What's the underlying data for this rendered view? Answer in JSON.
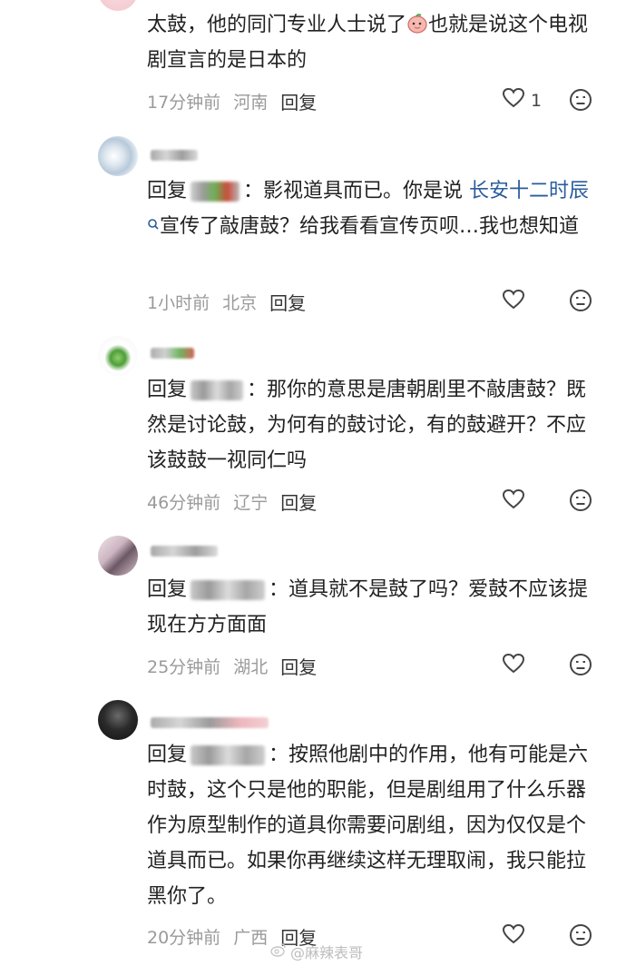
{
  "comments": [
    {
      "text_a": "太鼓，他的同门专业人士说了",
      "text_b": "也就是说这个电视剧宣言的是日本的",
      "time": "17分钟前",
      "location": "河南",
      "reply_label": "回复",
      "likes": "1"
    },
    {
      "reply_word": "回复",
      "text_a": "：影视道具而已。你是说 ",
      "link": "长安十二时辰",
      "text_b": "宣传了敲唐鼓？给我看看宣传页呗…我也想知道",
      "time": "1小时前",
      "location": "北京",
      "reply_label": "回复"
    },
    {
      "reply_word": "回复",
      "text_a": "：那你的意思是唐朝剧里不敲唐鼓？既然是讨论鼓，为何有的鼓讨论，有的鼓避开？不应该鼓鼓一视同仁吗",
      "time": "46分钟前",
      "location": "辽宁",
      "reply_label": "回复"
    },
    {
      "reply_word": "回复",
      "text_a": "：道具就不是鼓了吗？爱鼓不应该提现在方方面面",
      "time": "25分钟前",
      "location": "湖北",
      "reply_label": "回复"
    },
    {
      "reply_word": "回复",
      "text_a": "：按照他剧中的作用，他有可能是六时鼓，这个只是他的职能，但是剧组用了什么乐器作为原型制作的道具你需要问剧组，因为仅仅是个道具而已。如果你再继续这样无理取闹，我只能拉黑你了。",
      "time": "20分钟前",
      "location": "广西",
      "reply_label": "回复"
    }
  ],
  "watermark": "@麻辣表哥",
  "icons": {
    "like": "heart-outline-icon",
    "dislike": "sad-face-icon",
    "search": "search-magnifier-icon",
    "emoji": "peach-emoji-icon"
  },
  "colors": {
    "link": "#2a5c9e",
    "meta": "#9a9a9a",
    "text": "#222222"
  }
}
